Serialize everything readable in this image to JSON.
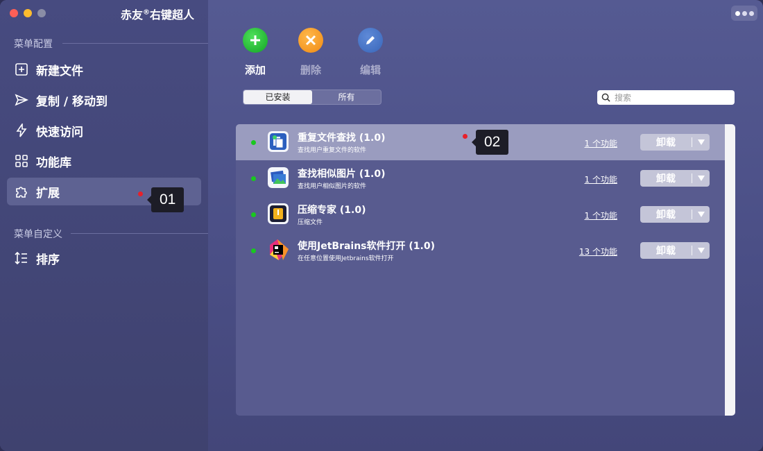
{
  "window": {
    "title_main": "赤友",
    "title_reg": "®",
    "title_suffix": "右键超人"
  },
  "sidebar": {
    "section1_label": "菜单配置",
    "section2_label": "菜单自定义",
    "items": [
      {
        "label": "新建文件",
        "icon": "plus-square-icon"
      },
      {
        "label": "复制 / 移动到",
        "icon": "send-icon"
      },
      {
        "label": "快速访问",
        "icon": "lightning-icon"
      },
      {
        "label": "功能库",
        "icon": "grid-icon"
      },
      {
        "label": "扩展",
        "icon": "puzzle-icon",
        "active": true
      }
    ],
    "sort_item": {
      "label": "排序",
      "icon": "sort-icon"
    }
  },
  "markers": {
    "marker1": "01",
    "marker2": "02"
  },
  "toolbar": {
    "add_label": "添加",
    "delete_label": "删除",
    "edit_label": "编辑"
  },
  "segment": {
    "installed": "已安装",
    "all": "所有",
    "selected": "已安装"
  },
  "search": {
    "placeholder": "搜索"
  },
  "extensions": [
    {
      "name": "重复文件查找 (1.0)",
      "desc": "查找用户重复文件的软件",
      "features": "1 个功能",
      "action": "卸载",
      "highlight": true
    },
    {
      "name": "查找相似图片 (1.0)",
      "desc": "查找用户相似图片的软件",
      "features": "1 个功能",
      "action": "卸载"
    },
    {
      "name": "压缩专家 (1.0)",
      "desc": "压缩文件",
      "features": "1 个功能",
      "action": "卸载"
    },
    {
      "name": "使用JetBrains软件打开 (1.0)",
      "desc": "在任意位置使用Jetbrains软件打开",
      "features": "13 个功能",
      "action": "卸载"
    }
  ],
  "colors": {
    "status_green": "#19c81f",
    "marker_red": "#e8202a",
    "add_green": "#12a424",
    "delete_orange": "#f08a12",
    "edit_blue": "#3866b9"
  }
}
